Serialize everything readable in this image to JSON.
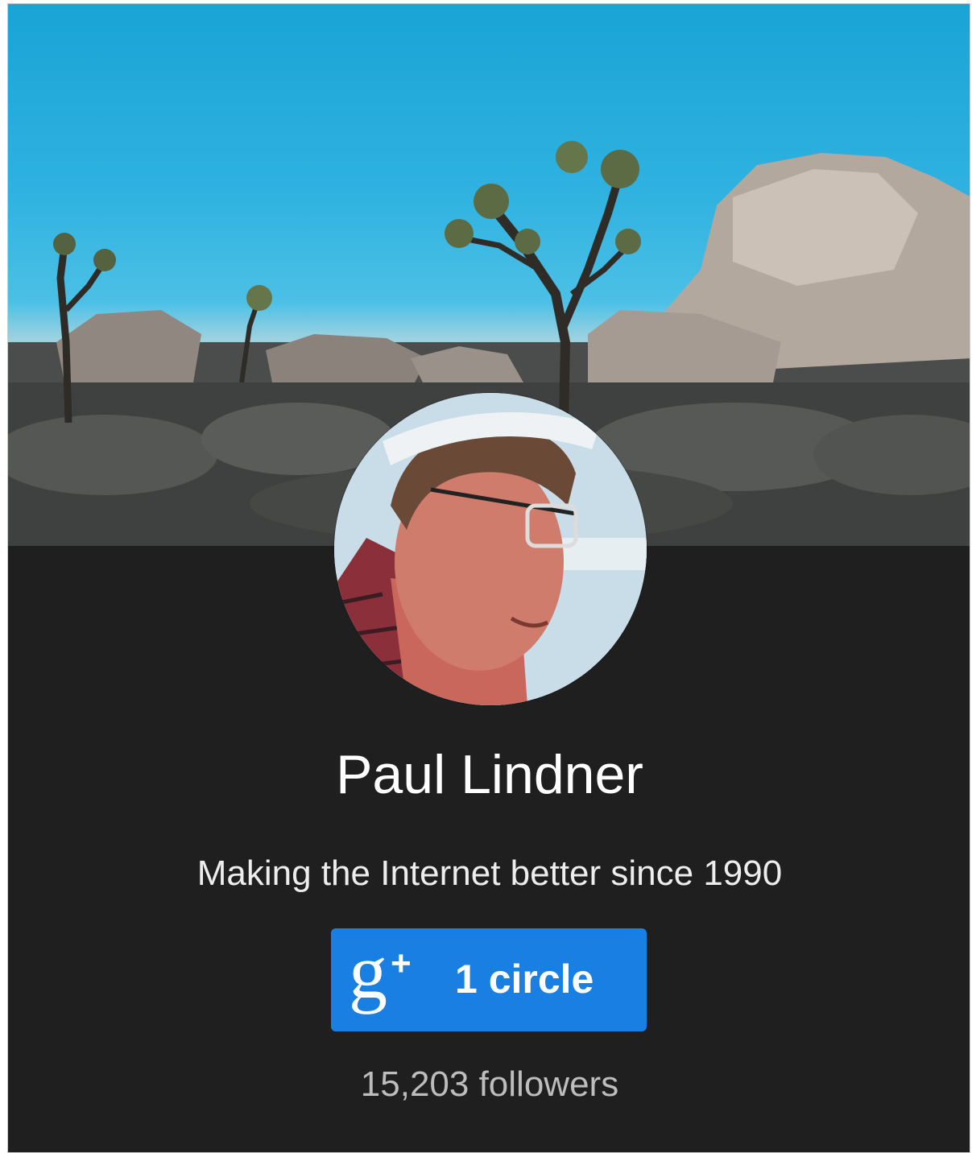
{
  "profile": {
    "name": "Paul Lindner",
    "tagline": "Making the Internet better since 1990",
    "followers": "15,203 followers"
  },
  "circle_button": {
    "icon": "google-plus-icon",
    "icon_glyph_g": "g",
    "icon_glyph_plus": "+",
    "label": "1 circle"
  },
  "colors": {
    "card_background": "#1f1f1f",
    "button_blue": "#1a7fe3",
    "sky": "#1aa3d6"
  }
}
